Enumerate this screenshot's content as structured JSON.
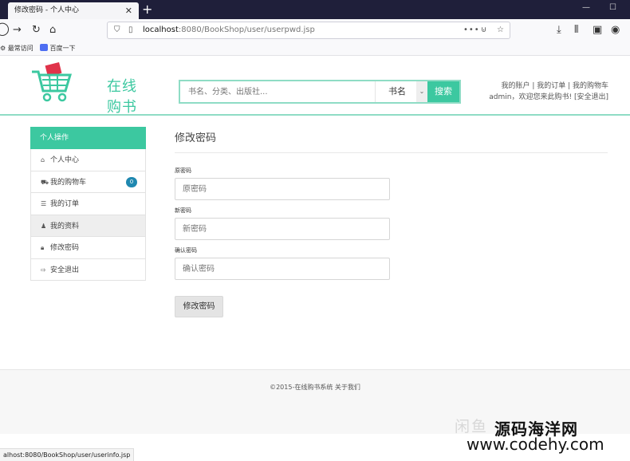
{
  "browser": {
    "tab_title": "修改密码 - 个人中心",
    "url_host": "localhost",
    "url_rest": ":8080/BookShop/user/userpwd.jsp",
    "bookmarks": [
      "最常访问",
      "百度一下"
    ],
    "status_url": "alhost:8080/BookShop/user/userinfo.jsp"
  },
  "header": {
    "logo_text": "在线购书",
    "search_placeholder": "书名、分类、出版社...",
    "search_type": "书名",
    "search_button": "搜索",
    "links_line1": "我的账户 |  我的订单 |  我的购物车",
    "links_line2": "admin，欢迎您来此购书! [安全退出]"
  },
  "sidebar": {
    "heading": "个人操作",
    "items": [
      {
        "label": "个人中心",
        "icon": "home-icon"
      },
      {
        "label": "我的购物车",
        "icon": "cart-icon",
        "badge": "0"
      },
      {
        "label": "我的订单",
        "icon": "list-icon"
      },
      {
        "label": "我的资料",
        "icon": "user-icon"
      },
      {
        "label": "修改密码",
        "icon": "lock-icon"
      },
      {
        "label": "安全退出",
        "icon": "logout-icon"
      }
    ]
  },
  "main": {
    "title": "修改密码",
    "fields": [
      {
        "label": "原密码",
        "placeholder": "原密码"
      },
      {
        "label": "新密码",
        "placeholder": "新密码"
      },
      {
        "label": "确认密码",
        "placeholder": "确认密码"
      }
    ],
    "submit_label": "修改密码"
  },
  "footer": {
    "text": "©2015-在线购书系统  关于我们"
  },
  "watermark": {
    "grey": "闲鱼",
    "site_name": "源码海洋网",
    "site_url": "www.codehy.com"
  },
  "colors": {
    "accent": "#3cc8a0",
    "badge": "#1f88b0"
  }
}
